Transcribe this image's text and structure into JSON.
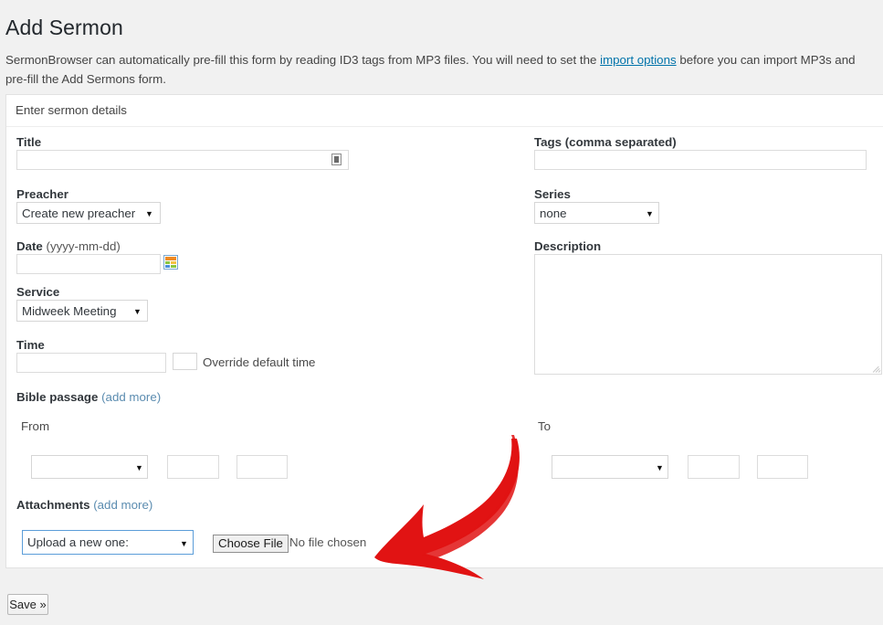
{
  "page": {
    "title": "Add Sermon",
    "intro_before_link": "SermonBrowser can automatically pre-fill this form by reading ID3 tags from MP3 files. You will need to set the ",
    "intro_link": "import options",
    "intro_after_link": " before you can import MP3s and pre-fill the Add Sermons form."
  },
  "panel": {
    "header": "Enter sermon details"
  },
  "form": {
    "title": {
      "label": "Title",
      "value": "",
      "icon": "id3-tag-icon"
    },
    "preacher": {
      "label": "Preacher",
      "selected": "Create new preacher",
      "options": [
        "Create new preacher"
      ]
    },
    "date": {
      "label_bold": "Date ",
      "label_light": "(yyyy-mm-dd)",
      "value": "",
      "icon": "calendar-icon"
    },
    "service": {
      "label": "Service",
      "selected": "Midweek Meeting",
      "options": [
        "Midweek Meeting"
      ]
    },
    "time": {
      "label": "Time",
      "value": "",
      "override_label": "Override default time",
      "override_checked": false
    },
    "bible_passage": {
      "label": "Bible passage ",
      "add_more": "(add more)"
    },
    "from": {
      "label": "From",
      "book_selected": "",
      "chapter": "",
      "verse": ""
    },
    "to": {
      "label": "To",
      "book_selected": "",
      "chapter": "",
      "verse": ""
    },
    "attachments": {
      "label": "Attachments ",
      "add_more": "(add more)"
    },
    "upload": {
      "selected": "Upload a new one:",
      "options": [
        "Upload a new one:"
      ],
      "choose_file_button": "Choose File",
      "no_file_text": "No file chosen"
    },
    "tags": {
      "label": "Tags (comma separated)",
      "value": ""
    },
    "series": {
      "label": "Series",
      "selected": "none",
      "options": [
        "none"
      ]
    },
    "description": {
      "label": "Description",
      "value": ""
    }
  },
  "footer": {
    "save_label": "Save »"
  },
  "annotation": {
    "arrow_color": "#e11313",
    "points_at": "choose-file-control"
  },
  "colors": {
    "page_background": "#f1f1f1",
    "panel_background": "#ffffff",
    "link": "#0073aa",
    "add_more_link": "#5b8cb0",
    "accent_focus": "#5b9dd9",
    "annotation_red": "#e11313"
  }
}
